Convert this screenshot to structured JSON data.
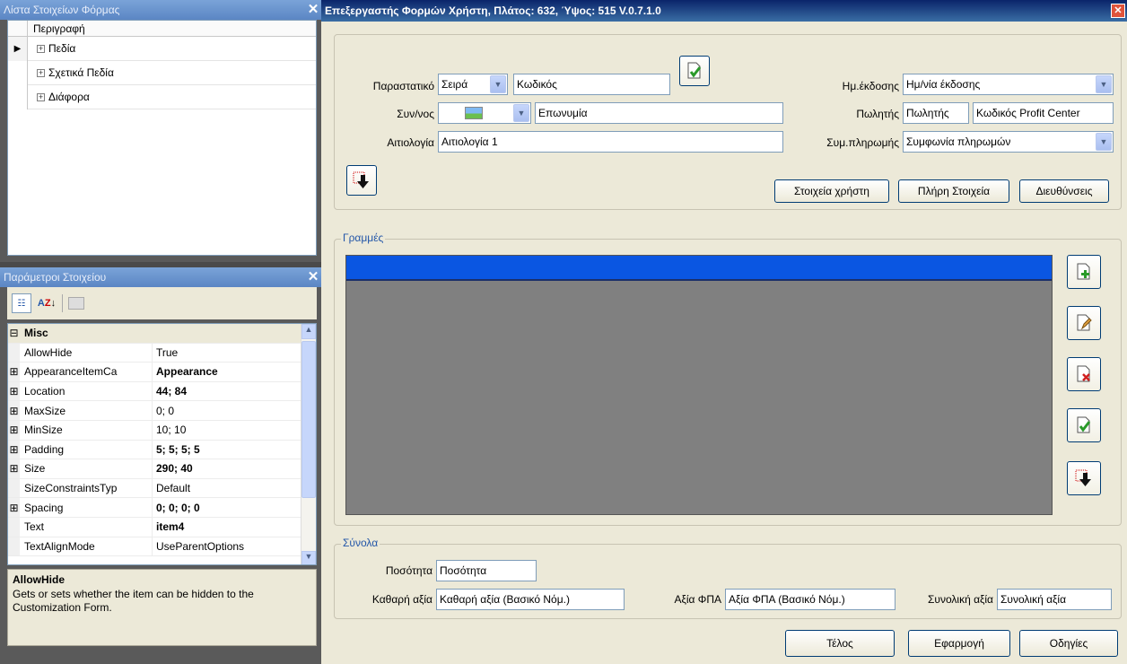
{
  "left_panel": {
    "form_items": {
      "title": "Λίστα Στοιχείων Φόρμας",
      "column_header": "Περιγραφή",
      "items": [
        {
          "label": "Πεδία"
        },
        {
          "label": "Σχετικά Πεδία"
        },
        {
          "label": "Διάφορα"
        }
      ]
    },
    "properties": {
      "title": "Παράμετροι Στοιχείου",
      "category": "Misc",
      "rows": [
        {
          "name": "AllowHide",
          "value": "True",
          "expandable": false,
          "bold": false
        },
        {
          "name": "AppearanceItemCa",
          "value": "Appearance",
          "expandable": true,
          "bold": true
        },
        {
          "name": "Location",
          "value": "44; 84",
          "expandable": true,
          "bold": true
        },
        {
          "name": "MaxSize",
          "value": "0; 0",
          "expandable": true,
          "bold": false
        },
        {
          "name": "MinSize",
          "value": "10; 10",
          "expandable": true,
          "bold": false
        },
        {
          "name": "Padding",
          "value": "5; 5; 5; 5",
          "expandable": true,
          "bold": true
        },
        {
          "name": "Size",
          "value": "290; 40",
          "expandable": true,
          "bold": true
        },
        {
          "name": "SizeConstraintsTyp",
          "value": "Default",
          "expandable": false,
          "bold": false
        },
        {
          "name": "Spacing",
          "value": "0; 0; 0; 0",
          "expandable": true,
          "bold": true
        },
        {
          "name": "Text",
          "value": "item4",
          "expandable": false,
          "bold": true
        },
        {
          "name": "TextAlignMode",
          "value": "UseParentOptions",
          "expandable": false,
          "bold": false
        }
      ],
      "description_title": "AllowHide",
      "description_text": "Gets or sets whether the item can be hidden to the Customization Form."
    }
  },
  "main": {
    "title": "Επεξεργαστής Φορμών Χρήστη, Πλάτος: 632, Ύψος: 515 V.0.7.1.0",
    "header": {
      "parastatiko_label": "Παραστατικό",
      "seira_value": "Σειρά",
      "kodikos_value": "Κωδικός",
      "synallassomenos_label": "Συν/νος",
      "eponymia_value": "Επωνυμία",
      "aitiologia_label": "Αιτιολογία",
      "aitiologia_value": "Αιτιολογία 1",
      "hm_ekdosis_label": "Ημ.έκδοσης",
      "hm_ekdosis_value": "Ημ/νία έκδοσης",
      "politis_label": "Πωλητής",
      "politis_value": "Πωλητής",
      "profit_center_value": "Κωδικός Profit Center",
      "symfonia_label": "Συμ.πληρωμής",
      "symfonia_value": "Συμφωνία πληρωμών",
      "user_data_button": "Στοιχεία χρήστη",
      "full_data_button": "Πλήρη Στοιχεία",
      "addresses_button": "Διευθύνσεις"
    },
    "lines": {
      "group_label": "Γραμμές"
    },
    "totals": {
      "group_label": "Σύνολα",
      "quantity_label": "Ποσότητα",
      "quantity_value": "Ποσότητα",
      "net_label": "Καθαρή αξία",
      "net_value": "Καθαρή αξία (Βασικό Νόμ.)",
      "vat_label": "Αξία ΦΠΑ",
      "vat_value": "Αξία ΦΠΑ (Βασικό Νόμ.)",
      "total_label": "Συνολική αξία",
      "total_value": "Συνολική αξία"
    },
    "footer": {
      "end_button": "Τέλος",
      "apply_button": "Εφαρμογή",
      "help_button": "Οδηγίες"
    }
  },
  "colors": {
    "title_bar": "#0a246a",
    "grid_header": "#0a56e2",
    "grid_body": "#808080",
    "group_label": "#2356a8"
  }
}
